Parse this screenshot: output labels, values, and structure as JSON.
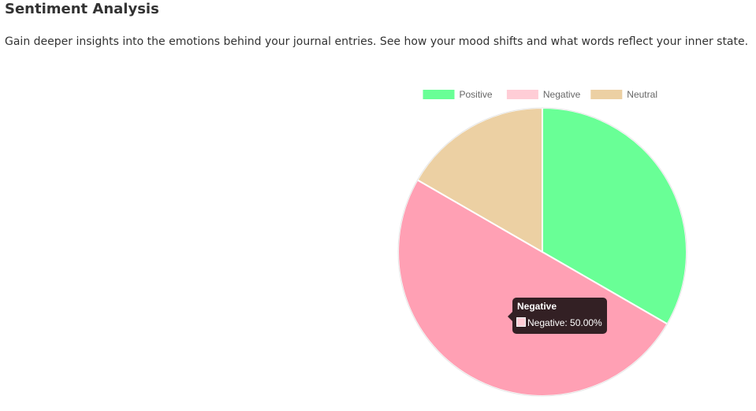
{
  "header": {
    "title": "Sentiment Analysis",
    "description": "Gain deeper insights into the emotions behind your journal entries. See how your mood shifts and what words reflect your inner state."
  },
  "chart_data": {
    "type": "pie",
    "categories": [
      "Positive",
      "Negative",
      "Neutral"
    ],
    "values": [
      33.33,
      50.0,
      16.67
    ],
    "colors": [
      "#69ff96",
      "#ffa0b4",
      "#ecd0a3"
    ],
    "legend_colors": [
      "#69ff96",
      "#ffcdd6",
      "#ecd0a3"
    ],
    "legend_position": "top",
    "start_angle": "top, clockwise"
  },
  "tooltip": {
    "title": "Negative",
    "label": "Negative: 50.00%",
    "swatch_color": "#ffcdd6"
  }
}
